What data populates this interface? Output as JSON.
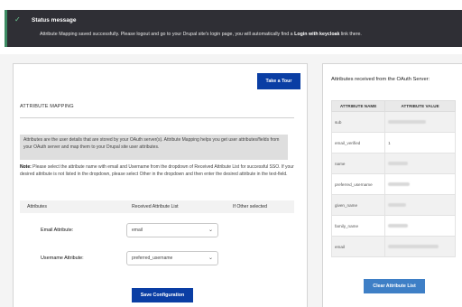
{
  "status": {
    "title": "Status message",
    "message_pre": "Attribute Mapping saved successfully. Please logout and go to your Drupal site's login page, you will automatically find a ",
    "message_bold": "Login with keycloak",
    "message_post": " link there."
  },
  "left": {
    "tour_button": "Take a Tour",
    "section_title": "ATTRIBUTE MAPPING",
    "info": "Attributes are the user details that are stored by your OAuth server(s). Attribute Mapping helps you get user attributes/fields from your OAuth server and map them to your Drupal site user attributes.",
    "note_label": "Note:",
    "note_text": " Please select the attribute name with email and Username from the dropdown of Received Attribute List for successful SSO. If your desired attribute is not listed in the dropdown, please select Other in the dropdown and then enter the desired attribute in the text-field.",
    "table_headers": [
      "Attributes",
      "Received Attribute List",
      "If Other selected"
    ],
    "rows": [
      {
        "label": "Email Attribute:",
        "value": "email"
      },
      {
        "label": "Username Attribute:",
        "value": "preferred_username"
      }
    ],
    "save_button": "Save Configuration"
  },
  "right": {
    "title": "Attributes received from the OAuth Server:",
    "headers": [
      "ATTRIBUTE NAME",
      "ATTRIBUTE VALUE"
    ],
    "attributes": [
      {
        "name": "sub",
        "value": ""
      },
      {
        "name": "email_verified",
        "value": "1"
      },
      {
        "name": "name",
        "value": ""
      },
      {
        "name": "preferred_username",
        "value": ""
      },
      {
        "name": "given_name",
        "value": ""
      },
      {
        "name": "family_name",
        "value": ""
      },
      {
        "name": "email",
        "value": ""
      }
    ],
    "clear_button": "Clear Attribute List"
  },
  "colors": {
    "primary_button": "#0a3ea4",
    "clear_button": "#3e7fc6",
    "status_bg": "#2f2f35",
    "status_accent": "#3d8b63"
  }
}
